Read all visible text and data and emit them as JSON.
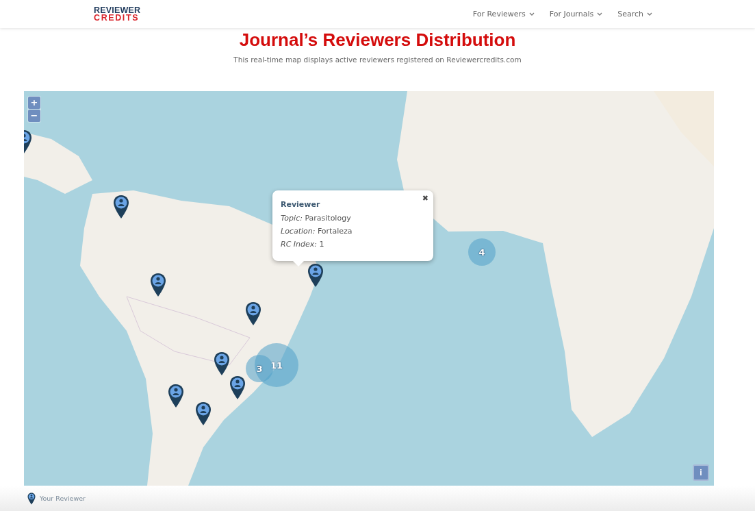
{
  "logo": {
    "line_1": "REVIEWER",
    "line_2": "CREDITS"
  },
  "nav": [
    {
      "label": "For Reviewers"
    },
    {
      "label": "For Journals"
    },
    {
      "label": "Search"
    }
  ],
  "title": "Journal’s Reviewers Distribution",
  "subtitle": "This real-time map displays active reviewers registered on Reviewercredits.com",
  "map": {
    "kind": "picture",
    "zoom_controls": [
      "+",
      "−"
    ],
    "markers": [
      {
        "kind": "pin"
      },
      {
        "kind": "pin"
      },
      {
        "kind": "pin"
      },
      {
        "kind": "pin"
      },
      {
        "kind": "pin"
      },
      {
        "kind": "pin"
      },
      {
        "kind": "pin"
      },
      {
        "kind": "pin"
      },
      {
        "kind": "pin"
      },
      {
        "kind": "cluster",
        "count": "4"
      },
      {
        "kind": "cluster",
        "count": "3"
      },
      {
        "kind": "cluster",
        "count": "11"
      }
    ],
    "popup": {
      "close": "✖",
      "title": "Reviewer",
      "fields": [
        {
          "label": "Topic:",
          "value": "Parasitology"
        },
        {
          "label": "Location:",
          "value": "Fortaleza"
        },
        {
          "label": "RC Index:",
          "value": "1"
        }
      ]
    },
    "info_button": "i"
  },
  "legend": {
    "label": "Your Reviewer"
  }
}
